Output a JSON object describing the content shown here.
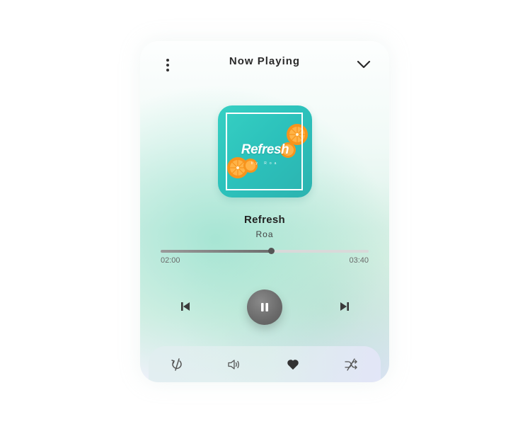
{
  "header": {
    "title": "Now Playing"
  },
  "album": {
    "title": "Refresh",
    "subtitle": "by Roa"
  },
  "track": {
    "name": "Refresh",
    "artist": "Roa"
  },
  "playback": {
    "current_time": "02:00",
    "total_time": "03:40",
    "progress_fraction": 0.529,
    "state": "playing"
  },
  "controls": {
    "previous_icon": "skip-previous-icon",
    "play_pause_icon": "pause-icon",
    "next_icon": "skip-next-icon"
  },
  "bottom_bar": {
    "icons": [
      "repeat-off-icon",
      "volume-icon",
      "heart-icon",
      "shuffle-off-icon"
    ]
  },
  "colors": {
    "accent": "#6e6e6e",
    "album_bg": "#2cc1bb",
    "orange": "#f7941d"
  }
}
